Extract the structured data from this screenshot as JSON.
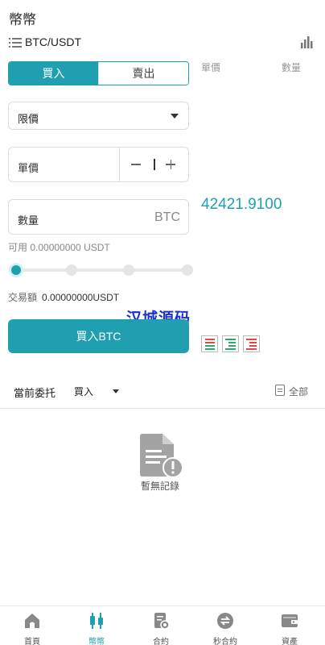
{
  "page": {
    "title": "幣幣"
  },
  "pair": {
    "name": "BTC/USDT",
    "list_icon": "list-icon",
    "chart_icon": "bar-chart-icon"
  },
  "trade_tabs": {
    "buy": "買入",
    "sell": "賣出",
    "active": "buy"
  },
  "orderbook": {
    "price_header": "單價",
    "amount_header": "數量"
  },
  "order_type": {
    "selected": "限價"
  },
  "price_input": {
    "label": "單價"
  },
  "amount_input": {
    "label": "數量",
    "unit": "BTC"
  },
  "last_price": "42421.9100",
  "available": "可用 0.00000000 USDT",
  "slider": {
    "stops": 4,
    "value_percent": 0
  },
  "turnover": {
    "label": "交易額",
    "value": "0.00000000USDT"
  },
  "watermark": "汉城源码",
  "buy_button": "買入BTC",
  "depth_modes": [
    "both",
    "buy",
    "sell"
  ],
  "orders": {
    "title": "當前委托",
    "side": "買入",
    "all": "全部"
  },
  "empty": {
    "text": "暫無記錄",
    "icon": "empty-document-icon"
  },
  "colors": {
    "accent": "#1f9fb0",
    "buy": "#2aa86d",
    "sell": "#e04848"
  },
  "tabbar": [
    {
      "label": "首頁",
      "icon": "home-icon",
      "active": false
    },
    {
      "label": "幣幣",
      "icon": "candlestick-icon",
      "active": true
    },
    {
      "label": "合約",
      "icon": "contract-icon",
      "active": false
    },
    {
      "label": "秒合約",
      "icon": "exchange-icon",
      "active": false
    },
    {
      "label": "資產",
      "icon": "wallet-icon",
      "active": false
    }
  ]
}
